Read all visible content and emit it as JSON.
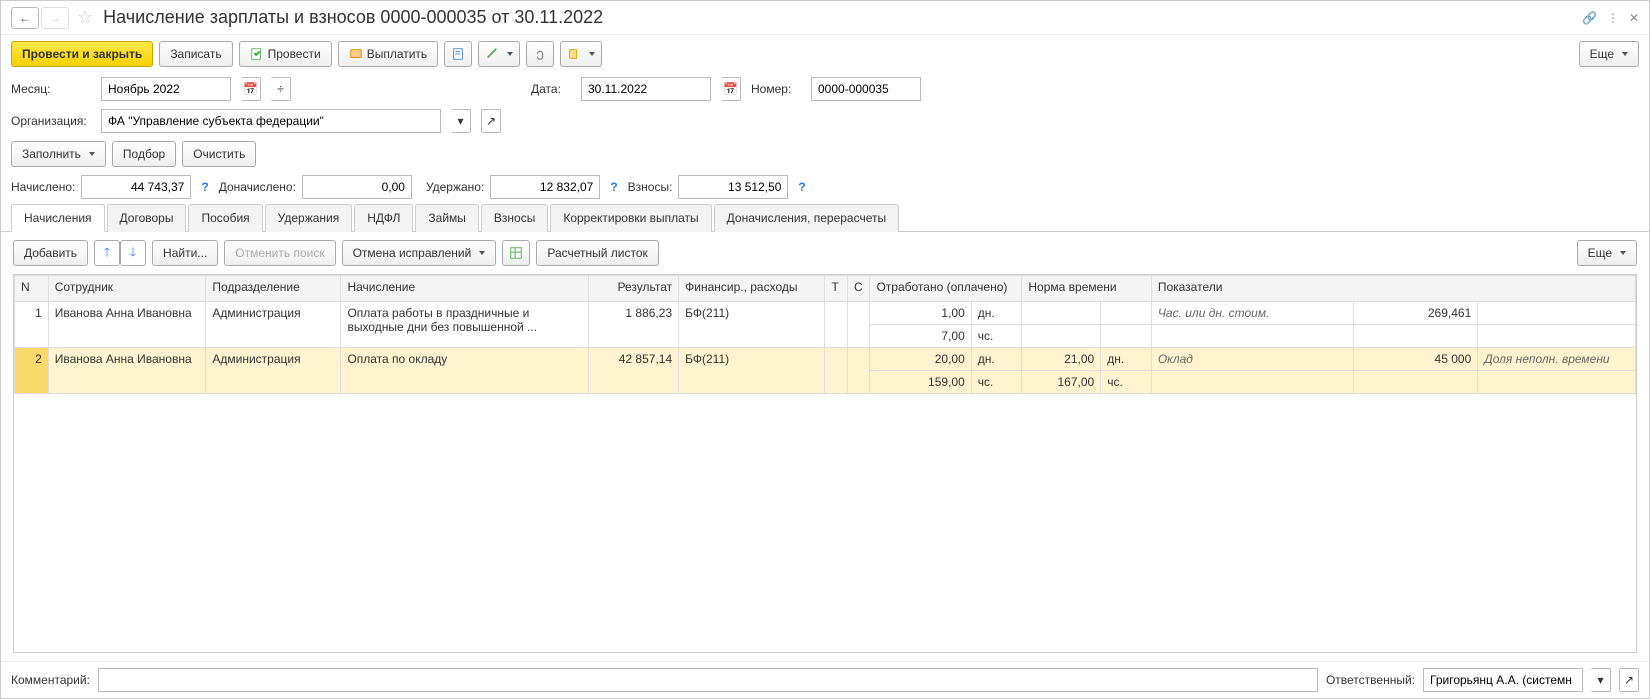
{
  "window": {
    "title": "Начисление зарплаты и взносов 0000-000035 от 30.11.2022"
  },
  "toolbar": {
    "post_and_close": "Провести и закрыть",
    "write": "Записать",
    "post": "Провести",
    "pay": "Выплатить",
    "more": "Еще"
  },
  "fields": {
    "month_label": "Месяц:",
    "month_value": "Ноябрь 2022",
    "date_label": "Дата:",
    "date_value": "30.11.2022",
    "number_label": "Номер:",
    "number_value": "0000-000035",
    "org_label": "Организация:",
    "org_value": "ФА \"Управление субъекта федерации\""
  },
  "fill_buttons": {
    "fill": "Заполнить",
    "select": "Подбор",
    "clear": "Очистить"
  },
  "totals": {
    "accrued_label": "Начислено:",
    "accrued_value": "44 743,37",
    "extra_accrued_label": "Доначислено:",
    "extra_accrued_value": "0,00",
    "withheld_label": "Удержано:",
    "withheld_value": "12 832,07",
    "contrib_label": "Взносы:",
    "contrib_value": "13 512,50"
  },
  "tabs": [
    "Начисления",
    "Договоры",
    "Пособия",
    "Удержания",
    "НДФЛ",
    "Займы",
    "Взносы",
    "Корректировки выплаты",
    "Доначисления, перерасчеты"
  ],
  "subtoolbar": {
    "add": "Добавить",
    "find": "Найти...",
    "cancel_find": "Отменить поиск",
    "cancel_fixes": "Отмена исправлений",
    "payslip": "Расчетный листок",
    "more": "Еще"
  },
  "grid": {
    "headers": {
      "n": "N",
      "emp": "Сотрудник",
      "dept": "Подразделение",
      "accr": "Начисление",
      "result": "Результат",
      "fin": "Финансир., расходы",
      "t": "Т",
      "c": "С",
      "worked": "Отработано (оплачено)",
      "norm": "Норма времени",
      "indic": "Показатели"
    },
    "rows": [
      {
        "n": "1",
        "emp": "Иванова Анна Ивановна",
        "dept": "Администрация",
        "accr": "Оплата работы в праздничные и выходные дни без повышенной ...",
        "result": "1 886,23",
        "fin": "БФ(211)",
        "worked_days": "1,00",
        "worked_days_unit": "дн.",
        "worked_hours": "7,00",
        "worked_hours_unit": "чс.",
        "norm_days": "",
        "norm_days_unit": "",
        "norm_hours": "",
        "norm_hours_unit": "",
        "ind_label": "Час. или дн. стоим.",
        "ind_val": "269,461",
        "ind_extra": ""
      },
      {
        "n": "2",
        "emp": "Иванова Анна Ивановна",
        "dept": "Администрация",
        "accr": "Оплата по окладу",
        "result": "42 857,14",
        "fin": "БФ(211)",
        "worked_days": "20,00",
        "worked_days_unit": "дн.",
        "worked_hours": "159,00",
        "worked_hours_unit": "чс.",
        "norm_days": "21,00",
        "norm_days_unit": "дн.",
        "norm_hours": "167,00",
        "norm_hours_unit": "чс.",
        "ind_label": "Оклад",
        "ind_val": "45 000",
        "ind_extra": "Доля неполн. времени"
      }
    ]
  },
  "footer": {
    "comment_label": "Комментарий:",
    "comment_value": "",
    "resp_label": "Ответственный:",
    "resp_value": "Григорьянц А.А. (системн"
  }
}
